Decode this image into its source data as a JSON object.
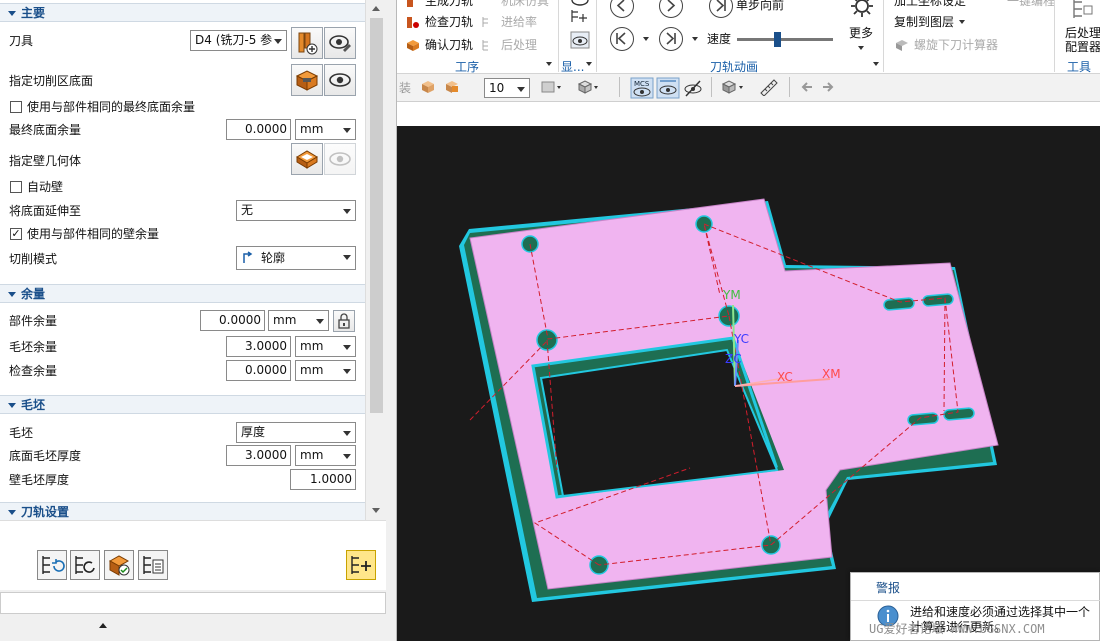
{
  "panel": {
    "main_title": "主要",
    "tool_label": "刀具",
    "tool_value": "D4 (铣刀-5 参",
    "floor_label": "指定切削区底面",
    "same_floor_label": "使用与部件相同的最终底面余量",
    "same_floor_checked": false,
    "final_floor_label": "最终底面余量",
    "final_floor_value": "0.0000",
    "unit": "mm",
    "wall_geom_label": "指定壁几何体",
    "auto_wall_label": "自动壁",
    "auto_wall_checked": false,
    "extend_label": "将底面延伸至",
    "extend_value": "无",
    "same_wall_label": "使用与部件相同的壁余量",
    "same_wall_checked": true,
    "cut_mode_label": "切削模式",
    "cut_mode_value": "轮廓",
    "stock_title": "余量",
    "part_stock_label": "部件余量",
    "part_stock_value": "0.0000",
    "blank_stock_label": "毛坯余量",
    "blank_stock_value": "3.0000",
    "check_stock_label": "检查余量",
    "check_stock_value": "0.0000",
    "blank_title": "毛坯",
    "blank_label": "毛坯",
    "blank_value": "厚度",
    "floor_blank_label": "底面毛坯厚度",
    "floor_blank_value": "3.0000",
    "wall_blank_label": "壁毛坯厚度",
    "wall_blank_value": "1.0000",
    "toolpath_title": "刀轨设置"
  },
  "ribbon": {
    "gen": "生成刀轨",
    "check": "检查刀轨",
    "confirm": "确认刀轨",
    "machine_sim": "机床仿真",
    "feed": "进给率",
    "postproc": "后处理",
    "group_ops": "工序",
    "group_display": "显...",
    "step_forward": "单步向前",
    "speed": "速度",
    "more": "更多",
    "group_anim": "刀轨动画",
    "coord": "加工坐标设定",
    "copy_layer": "复制到图层",
    "thread": "螺旋下刀计算器",
    "quick": "一键编程",
    "post_cfg_1": "后处理",
    "post_cfg_2": "配置器",
    "group_tools": "工具",
    "speed_value": 0.42
  },
  "toolbar": {
    "count_value": "10",
    "label_left": "装"
  },
  "viewport": {
    "xm": "XM",
    "ym": "YM",
    "xc": "XC",
    "yc": "YC",
    "zc": "ZC"
  },
  "alert": {
    "title": "警报",
    "message": "进给和速度必须通过选择其中一个计算器进行更新。"
  },
  "watermark": "UG爱好者论坛 WWW.UGSNX.COM",
  "colors": {
    "plate": "#f0b4f0",
    "base": "#1e6e52",
    "edge": "#22c8e0",
    "toolpath": "#d21e2d",
    "viewport_bg": "#1a1a1a",
    "accent": "#1a5fa8"
  }
}
